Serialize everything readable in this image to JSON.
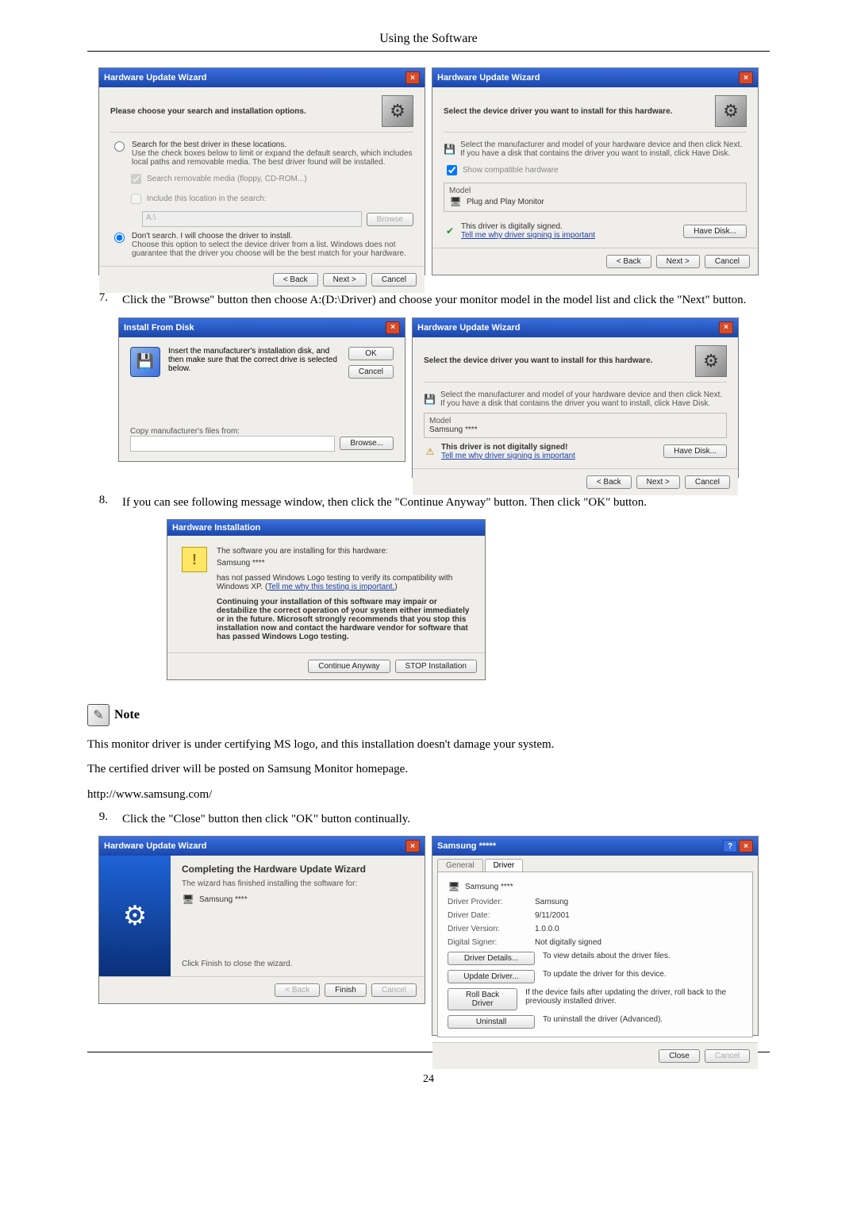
{
  "header": {
    "title": "Using the Software"
  },
  "dlg_search": {
    "title": "Hardware Update Wizard",
    "head": "Please choose your search and installation options.",
    "opt1": "Search for the best driver in these locations.",
    "opt1_desc": "Use the check boxes below to limit or expand the default search, which includes local paths and removable media. The best driver found will be installed.",
    "chk1": "Search removable media (floppy, CD-ROM...)",
    "chk2": "Include this location in the search:",
    "path": "A:\\",
    "opt2": "Don't search. I will choose the driver to install.",
    "opt2_desc": "Choose this option to select the device driver from a list. Windows does not guarantee that the driver you choose will be the best match for your hardware.",
    "back": "< Back",
    "next": "Next >",
    "cancel": "Cancel",
    "browse": "Browse"
  },
  "dlg_select1": {
    "title": "Hardware Update Wizard",
    "head": "Select the device driver you want to install for this hardware.",
    "desc": "Select the manufacturer and model of your hardware device and then click Next. If you have a disk that contains the driver you want to install, click Have Disk.",
    "show_compat": "Show compatible hardware",
    "model_lbl": "Model",
    "model_item": "Plug and Play Monitor",
    "signed": "This driver is digitally signed.",
    "tell_link": "Tell me why driver signing is important",
    "have_disk": "Have Disk...",
    "back": "< Back",
    "next": "Next >",
    "cancel": "Cancel"
  },
  "step7": {
    "num": "7.",
    "text": "Click the \"Browse\" button then choose A:(D:\\Driver) and choose your monitor model in the model list and click the \"Next\" button."
  },
  "dlg_install": {
    "title": "Install From Disk",
    "msg": "Insert the manufacturer's installation disk, and then make sure that the correct drive is selected below.",
    "ok": "OK",
    "cancel": "Cancel",
    "copy_lbl": "Copy manufacturer's files from:",
    "path": "",
    "browse": "Browse..."
  },
  "dlg_select2": {
    "title": "Hardware Update Wizard",
    "head": "Select the device driver you want to install for this hardware.",
    "desc": "Select the manufacturer and model of your hardware device and then click Next. If you have a disk that contains the driver you want to install, click Have Disk.",
    "model_lbl": "Model",
    "model_item": "Samsung ****",
    "not_signed": "This driver is not digitally signed!",
    "tell_link": "Tell me why driver signing is important",
    "have_disk": "Have Disk...",
    "back": "< Back",
    "next": "Next >",
    "cancel": "Cancel"
  },
  "step8": {
    "num": "8.",
    "text": "If you can see following message window, then click the \"Continue Anyway\" button. Then click \"OK\" button."
  },
  "dlg_hwinstall": {
    "title": "Hardware Installation",
    "line1": "The software you are installing for this hardware:",
    "device": "Samsung ****",
    "line2a": "has not passed Windows Logo testing to verify its compatibility with Windows XP. (",
    "line2b": "Tell me why this testing is important.",
    "line2c": ")",
    "bold": "Continuing your installation of this software may impair or destabilize the correct operation of your system either immediately or in the future. Microsoft strongly recommends that you stop this installation now and contact the hardware vendor for software that has passed Windows Logo testing.",
    "continue_btn": "Continue Anyway",
    "stop_btn": "STOP Installation"
  },
  "note": {
    "label": "Note",
    "p1": "This monitor driver is under certifying MS logo, and this installation doesn't damage your system.",
    "p2": "The certified driver will be posted on Samsung Monitor homepage.",
    "p3": "http://www.samsung.com/"
  },
  "step9": {
    "num": "9.",
    "text": "Click the \"Close\" button then click \"OK\" button continually."
  },
  "dlg_complete": {
    "title": "Hardware Update Wizard",
    "head": "Completing the Hardware Update Wizard",
    "line1": "The wizard has finished installing the software for:",
    "device": "Samsung ****",
    "line2": "Click Finish to close the wizard.",
    "back": "< Back",
    "finish": "Finish",
    "cancel": "Cancel"
  },
  "dlg_props": {
    "title": "Samsung *****",
    "tab1": "General",
    "tab2": "Driver",
    "device": "Samsung ****",
    "provider_lbl": "Driver Provider:",
    "provider": "Samsung",
    "date_lbl": "Driver Date:",
    "date": "9/11/2001",
    "version_lbl": "Driver Version:",
    "version": "1.0.0.0",
    "signer_lbl": "Digital Signer:",
    "signer": "Not digitally signed",
    "details_btn": "Driver Details...",
    "details_desc": "To view details about the driver files.",
    "update_btn": "Update Driver...",
    "update_desc": "To update the driver for this device.",
    "roll_btn": "Roll Back Driver",
    "roll_desc": "If the device fails after updating the driver, roll back to the previously installed driver.",
    "uninstall_btn": "Uninstall",
    "uninstall_desc": "To uninstall the driver (Advanced).",
    "close": "Close",
    "cancel": "Cancel"
  },
  "footer": {
    "page": "24"
  }
}
